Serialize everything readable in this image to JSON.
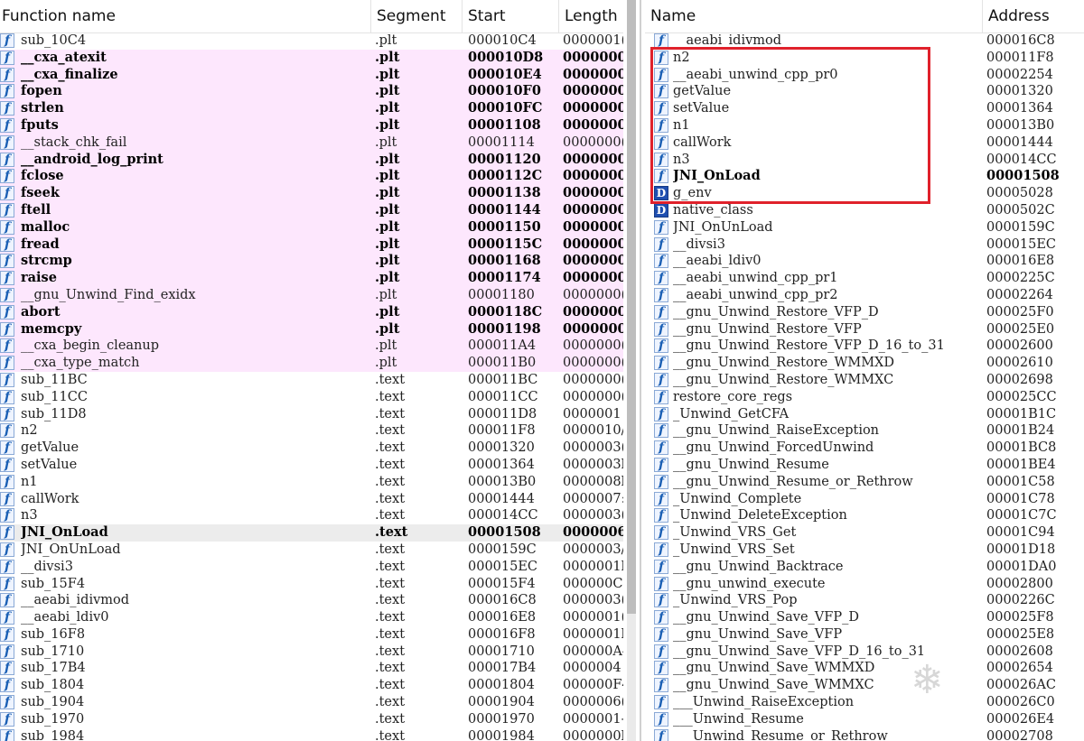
{
  "left_pane": {
    "columns": [
      "Function name",
      "Segment",
      "Start",
      "Length"
    ],
    "rows": [
      {
        "name": "sub_10C4",
        "seg": ".plt",
        "start": "000010C4",
        "len": "0000001(",
        "style": ""
      },
      {
        "name": "__cxa_atexit",
        "seg": ".plt",
        "start": "000010D8",
        "len": "0000000(",
        "style": "pink bold"
      },
      {
        "name": "__cxa_finalize",
        "seg": ".plt",
        "start": "000010E4",
        "len": "0000000(",
        "style": "pink bold"
      },
      {
        "name": "fopen",
        "seg": ".plt",
        "start": "000010F0",
        "len": "0000000(",
        "style": "pink bold"
      },
      {
        "name": "strlen",
        "seg": ".plt",
        "start": "000010FC",
        "len": "0000000(",
        "style": "pink bold"
      },
      {
        "name": "fputs",
        "seg": ".plt",
        "start": "00001108",
        "len": "0000000(",
        "style": "pink bold"
      },
      {
        "name": "__stack_chk_fail",
        "seg": ".plt",
        "start": "00001114",
        "len": "0000000(",
        "style": "pink"
      },
      {
        "name": "__android_log_print",
        "seg": ".plt",
        "start": "00001120",
        "len": "0000000(",
        "style": "pink bold"
      },
      {
        "name": "fclose",
        "seg": ".plt",
        "start": "0000112C",
        "len": "0000000(",
        "style": "pink bold"
      },
      {
        "name": "fseek",
        "seg": ".plt",
        "start": "00001138",
        "len": "0000000(",
        "style": "pink bold"
      },
      {
        "name": "ftell",
        "seg": ".plt",
        "start": "00001144",
        "len": "0000000(",
        "style": "pink bold"
      },
      {
        "name": "malloc",
        "seg": ".plt",
        "start": "00001150",
        "len": "0000000(",
        "style": "pink bold"
      },
      {
        "name": "fread",
        "seg": ".plt",
        "start": "0000115C",
        "len": "0000000(",
        "style": "pink bold"
      },
      {
        "name": "strcmp",
        "seg": ".plt",
        "start": "00001168",
        "len": "0000000(",
        "style": "pink bold"
      },
      {
        "name": "raise",
        "seg": ".plt",
        "start": "00001174",
        "len": "0000000(",
        "style": "pink bold"
      },
      {
        "name": "__gnu_Unwind_Find_exidx",
        "seg": ".plt",
        "start": "00001180",
        "len": "0000000(",
        "style": "pink"
      },
      {
        "name": "abort",
        "seg": ".plt",
        "start": "0000118C",
        "len": "0000000(",
        "style": "pink bold"
      },
      {
        "name": "memcpy",
        "seg": ".plt",
        "start": "00001198",
        "len": "0000000(",
        "style": "pink bold"
      },
      {
        "name": "__cxa_begin_cleanup",
        "seg": ".plt",
        "start": "000011A4",
        "len": "0000000(",
        "style": "pink"
      },
      {
        "name": "__cxa_type_match",
        "seg": ".plt",
        "start": "000011B0",
        "len": "0000000(",
        "style": "pink"
      },
      {
        "name": "sub_11BC",
        "seg": ".text",
        "start": "000011BC",
        "len": "0000000(",
        "style": ""
      },
      {
        "name": "sub_11CC",
        "seg": ".text",
        "start": "000011CC",
        "len": "0000000(",
        "style": ""
      },
      {
        "name": "sub_11D8",
        "seg": ".text",
        "start": "000011D8",
        "len": "0000001",
        "style": ""
      },
      {
        "name": "n2",
        "seg": ".text",
        "start": "000011F8",
        "len": "0000010/",
        "style": ""
      },
      {
        "name": "getValue",
        "seg": ".text",
        "start": "00001320",
        "len": "0000003(",
        "style": ""
      },
      {
        "name": "setValue",
        "seg": ".text",
        "start": "00001364",
        "len": "0000003l",
        "style": ""
      },
      {
        "name": "n1",
        "seg": ".text",
        "start": "000013B0",
        "len": "0000008l",
        "style": ""
      },
      {
        "name": "callWork",
        "seg": ".text",
        "start": "00001444",
        "len": "0000007:",
        "style": ""
      },
      {
        "name": "n3",
        "seg": ".text",
        "start": "000014CC",
        "len": "0000003(",
        "style": ""
      },
      {
        "name": "JNI_OnLoad",
        "seg": ".text",
        "start": "00001508",
        "len": "0000006",
        "style": "sel bold"
      },
      {
        "name": "JNI_OnUnLoad",
        "seg": ".text",
        "start": "0000159C",
        "len": "0000003/",
        "style": ""
      },
      {
        "name": "__divsi3",
        "seg": ".text",
        "start": "000015EC",
        "len": "0000001l",
        "style": ""
      },
      {
        "name": "sub_15F4",
        "seg": ".text",
        "start": "000015F4",
        "len": "000000C4",
        "style": ""
      },
      {
        "name": "__aeabi_idivmod",
        "seg": ".text",
        "start": "000016C8",
        "len": "0000003(",
        "style": ""
      },
      {
        "name": "__aeabi_ldiv0",
        "seg": ".text",
        "start": "000016E8",
        "len": "0000001(",
        "style": ""
      },
      {
        "name": "sub_16F8",
        "seg": ".text",
        "start": "000016F8",
        "len": "0000001l",
        "style": ""
      },
      {
        "name": "sub_1710",
        "seg": ".text",
        "start": "00001710",
        "len": "000000A4",
        "style": ""
      },
      {
        "name": "sub_17B4",
        "seg": ".text",
        "start": "000017B4",
        "len": "0000004",
        "style": ""
      },
      {
        "name": "sub_1804",
        "seg": ".text",
        "start": "00001804",
        "len": "000000F4",
        "style": ""
      },
      {
        "name": "sub_1904",
        "seg": ".text",
        "start": "00001904",
        "len": "0000006(",
        "style": ""
      },
      {
        "name": "sub_1970",
        "seg": ".text",
        "start": "00001970",
        "len": "0000001-",
        "style": ""
      },
      {
        "name": "sub_1984",
        "seg": ".text",
        "start": "00001984",
        "len": "0000000l",
        "style": ""
      }
    ]
  },
  "right_pane": {
    "columns": [
      "Name",
      "Address"
    ],
    "rows": [
      {
        "name": "__aeabi_idivmod",
        "addr": "000016C8",
        "icon": "f",
        "style": ""
      },
      {
        "name": "n2",
        "addr": "000011F8",
        "icon": "f",
        "style": ""
      },
      {
        "name": "__aeabi_unwind_cpp_pr0",
        "addr": "00002254",
        "icon": "f",
        "style": ""
      },
      {
        "name": "getValue",
        "addr": "00001320",
        "icon": "f",
        "style": ""
      },
      {
        "name": "setValue",
        "addr": "00001364",
        "icon": "f",
        "style": ""
      },
      {
        "name": "n1",
        "addr": "000013B0",
        "icon": "f",
        "style": ""
      },
      {
        "name": "callWork",
        "addr": "00001444",
        "icon": "f",
        "style": ""
      },
      {
        "name": "n3",
        "addr": "000014CC",
        "icon": "f",
        "style": ""
      },
      {
        "name": "JNI_OnLoad",
        "addr": "00001508",
        "icon": "f",
        "style": "bold"
      },
      {
        "name": "g_env",
        "addr": "00005028",
        "icon": "D",
        "style": ""
      },
      {
        "name": "native_class",
        "addr": "0000502C",
        "icon": "D",
        "style": ""
      },
      {
        "name": "JNI_OnUnLoad",
        "addr": "0000159C",
        "icon": "f",
        "style": ""
      },
      {
        "name": "__divsi3",
        "addr": "000015EC",
        "icon": "f",
        "style": ""
      },
      {
        "name": "__aeabi_ldiv0",
        "addr": "000016E8",
        "icon": "f",
        "style": ""
      },
      {
        "name": "__aeabi_unwind_cpp_pr1",
        "addr": "0000225C",
        "icon": "f",
        "style": ""
      },
      {
        "name": "__aeabi_unwind_cpp_pr2",
        "addr": "00002264",
        "icon": "f",
        "style": ""
      },
      {
        "name": "__gnu_Unwind_Restore_VFP_D",
        "addr": "000025F0",
        "icon": "f",
        "style": ""
      },
      {
        "name": "__gnu_Unwind_Restore_VFP",
        "addr": "000025E0",
        "icon": "f",
        "style": ""
      },
      {
        "name": "__gnu_Unwind_Restore_VFP_D_16_to_31",
        "addr": "00002600",
        "icon": "f",
        "style": ""
      },
      {
        "name": "__gnu_Unwind_Restore_WMMXD",
        "addr": "00002610",
        "icon": "f",
        "style": ""
      },
      {
        "name": "__gnu_Unwind_Restore_WMMXC",
        "addr": "00002698",
        "icon": "f",
        "style": ""
      },
      {
        "name": "restore_core_regs",
        "addr": "000025CC",
        "icon": "f",
        "style": ""
      },
      {
        "name": "_Unwind_GetCFA",
        "addr": "00001B1C",
        "icon": "f",
        "style": ""
      },
      {
        "name": "__gnu_Unwind_RaiseException",
        "addr": "00001B24",
        "icon": "f",
        "style": ""
      },
      {
        "name": "__gnu_Unwind_ForcedUnwind",
        "addr": "00001BC8",
        "icon": "f",
        "style": ""
      },
      {
        "name": "__gnu_Unwind_Resume",
        "addr": "00001BE4",
        "icon": "f",
        "style": ""
      },
      {
        "name": "__gnu_Unwind_Resume_or_Rethrow",
        "addr": "00001C58",
        "icon": "f",
        "style": ""
      },
      {
        "name": "_Unwind_Complete",
        "addr": "00001C78",
        "icon": "f",
        "style": ""
      },
      {
        "name": "_Unwind_DeleteException",
        "addr": "00001C7C",
        "icon": "f",
        "style": ""
      },
      {
        "name": "_Unwind_VRS_Get",
        "addr": "00001C94",
        "icon": "f",
        "style": ""
      },
      {
        "name": "_Unwind_VRS_Set",
        "addr": "00001D18",
        "icon": "f",
        "style": ""
      },
      {
        "name": "__gnu_Unwind_Backtrace",
        "addr": "00001DA0",
        "icon": "f",
        "style": ""
      },
      {
        "name": "__gnu_unwind_execute",
        "addr": "00002800",
        "icon": "f",
        "style": ""
      },
      {
        "name": "_Unwind_VRS_Pop",
        "addr": "0000226C",
        "icon": "f",
        "style": ""
      },
      {
        "name": "__gnu_Unwind_Save_VFP_D",
        "addr": "000025F8",
        "icon": "f",
        "style": ""
      },
      {
        "name": "__gnu_Unwind_Save_VFP",
        "addr": "000025E8",
        "icon": "f",
        "style": ""
      },
      {
        "name": "__gnu_Unwind_Save_VFP_D_16_to_31",
        "addr": "00002608",
        "icon": "f",
        "style": ""
      },
      {
        "name": "__gnu_Unwind_Save_WMMXD",
        "addr": "00002654",
        "icon": "f",
        "style": ""
      },
      {
        "name": "__gnu_Unwind_Save_WMMXC",
        "addr": "000026AC",
        "icon": "f",
        "style": ""
      },
      {
        "name": "___Unwind_RaiseException",
        "addr": "000026C0",
        "icon": "f",
        "style": ""
      },
      {
        "name": "___Unwind_Resume",
        "addr": "000026E4",
        "icon": "f",
        "style": ""
      },
      {
        "name": "___Unwind_Resume_or_Rethrow",
        "addr": "00002708",
        "icon": "f",
        "style": ""
      }
    ]
  },
  "colors": {
    "highlight": "#e0212b",
    "pink_row": "#fde7fd",
    "icon_blue": "#1a5fb4"
  },
  "icons": {
    "function": "f",
    "data": "D"
  }
}
